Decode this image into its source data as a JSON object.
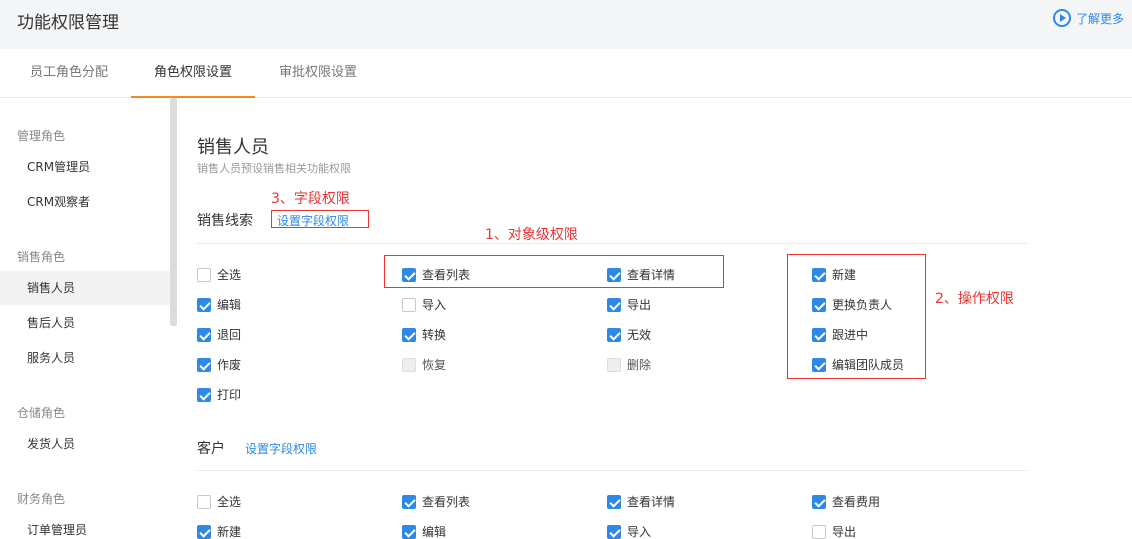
{
  "header": {
    "title": "功能权限管理",
    "more_label": "了解更多"
  },
  "tabs": [
    {
      "label": "员工角色分配"
    },
    {
      "label": "角色权限设置"
    },
    {
      "label": "审批权限设置"
    }
  ],
  "sidebar": {
    "groups": [
      {
        "label": "管理角色",
        "items": [
          "CRM管理员",
          "CRM观察者"
        ]
      },
      {
        "label": "销售角色",
        "items": [
          "销售人员",
          "售后人员",
          "服务人员"
        ]
      },
      {
        "label": "仓储角色",
        "items": [
          "发货人员"
        ]
      },
      {
        "label": "财务角色",
        "items": [
          "订单管理员"
        ]
      }
    ],
    "active_item": "销售人员"
  },
  "main": {
    "role_title": "销售人员",
    "role_desc": "销售人员预设销售相关功能权限",
    "sections": [
      {
        "title": "销售线索",
        "field_link": "设置字段权限",
        "permissions": [
          {
            "label": "全选",
            "state": "unchecked"
          },
          {
            "label": "查看列表",
            "state": "checked"
          },
          {
            "label": "查看详情",
            "state": "checked"
          },
          {
            "label": "新建",
            "state": "checked"
          },
          {
            "label": "编辑",
            "state": "checked"
          },
          {
            "label": "导入",
            "state": "unchecked"
          },
          {
            "label": "导出",
            "state": "checked"
          },
          {
            "label": "更换负责人",
            "state": "checked"
          },
          {
            "label": "退回",
            "state": "checked"
          },
          {
            "label": "转换",
            "state": "checked"
          },
          {
            "label": "无效",
            "state": "checked"
          },
          {
            "label": "跟进中",
            "state": "checked"
          },
          {
            "label": "作废",
            "state": "checked"
          },
          {
            "label": "恢复",
            "state": "disabled"
          },
          {
            "label": "删除",
            "state": "disabled"
          },
          {
            "label": "编辑团队成员",
            "state": "checked"
          },
          {
            "label": "打印",
            "state": "checked"
          }
        ]
      },
      {
        "title": "客户",
        "field_link": "设置字段权限",
        "permissions": [
          {
            "label": "全选",
            "state": "unchecked"
          },
          {
            "label": "查看列表",
            "state": "checked"
          },
          {
            "label": "查看详情",
            "state": "checked"
          },
          {
            "label": "查看费用",
            "state": "checked"
          },
          {
            "label": "新建",
            "state": "checked"
          },
          {
            "label": "编辑",
            "state": "checked"
          },
          {
            "label": "导入",
            "state": "checked"
          },
          {
            "label": "导出",
            "state": "unchecked"
          }
        ]
      }
    ]
  },
  "annotations": {
    "field_permission": "3、字段权限",
    "object_permission": "1、对象级权限",
    "operation_permission": "2、操作权限"
  },
  "colors": {
    "accent": "#2e88e6",
    "tab_active": "#f08a24",
    "annotation": "#e33333"
  }
}
